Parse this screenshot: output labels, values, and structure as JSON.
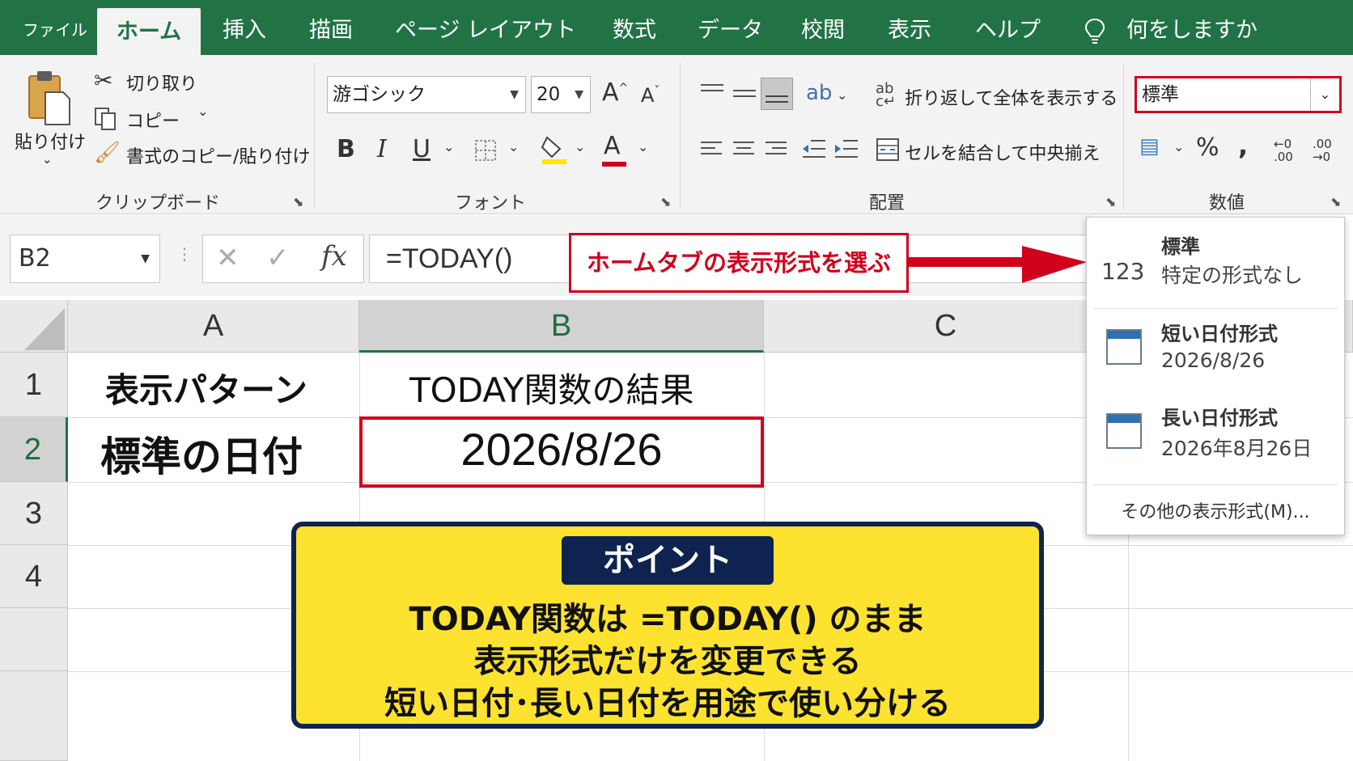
{
  "tabs": [
    "ファイル",
    "ホーム",
    "挿入",
    "描画",
    "ページ レイアウト",
    "数式",
    "データ",
    "校閲",
    "表示",
    "ヘルプ"
  ],
  "tell_me": "何をしますか",
  "clipboard": {
    "paste": "貼り付け",
    "cut": "切り取り",
    "copy": "コピー",
    "format_painter": "書式のコピー/貼り付け",
    "label": "クリップボード"
  },
  "font": {
    "name": "游ゴシック",
    "size": "20",
    "bold": "B",
    "italic": "I",
    "underline": "U",
    "grow": "A",
    "shrink": "A",
    "color_a": "A",
    "label": "フォント"
  },
  "alignment": {
    "wrap": "折り返して全体を表示する",
    "merge": "セルを結合して中央揃え",
    "label": "配置"
  },
  "number": {
    "format": "標準",
    "percent": "%",
    "comma": ",",
    "inc": "←0 .00",
    "dec": ".00 →0",
    "label": "数値"
  },
  "formula_bar": {
    "name_box": "B2",
    "fx": "fx",
    "formula": "=TODAY()"
  },
  "callout": "ホームタブの表示形式を選ぶ",
  "grid": {
    "columns": [
      "A",
      "B",
      "C"
    ],
    "rows": [
      "1",
      "2",
      "3",
      "4"
    ],
    "a1": "表示パターン",
    "b1": "TODAY関数の結果",
    "a2": "標準の日付",
    "b2": "2026/8/26"
  },
  "point": {
    "badge": "ポイント",
    "lines": [
      "TODAY関数は =TODAY() のまま",
      "表示形式だけを変更できる",
      "短い日付･長い日付を用途で使い分ける"
    ]
  },
  "format_menu": {
    "items": [
      {
        "title": "標準",
        "icon_text": "123",
        "subtitle": "特定の形式なし"
      },
      {
        "title": "短い日付形式",
        "subtitle": "2026/8/26"
      },
      {
        "title": "長い日付形式",
        "subtitle": "2026年8月26日"
      }
    ],
    "more": "その他の表示形式(M)..."
  },
  "colors": {
    "excel_green": "#217346",
    "highlight_red": "#d0021b",
    "point_yellow": "#fde330",
    "point_navy": "#0e2350"
  }
}
